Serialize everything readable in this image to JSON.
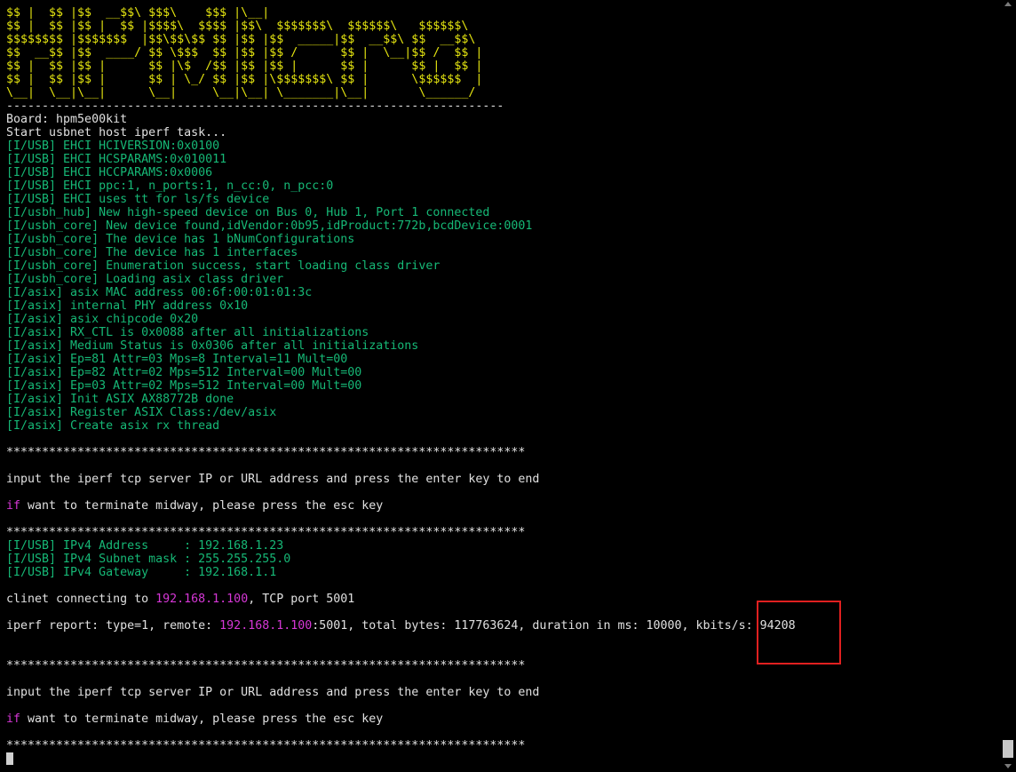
{
  "colors": {
    "background": "#000000",
    "banner": "#e5e510",
    "plain": "#e0e0e0",
    "log": "#16b876",
    "highlight": "#d637d6",
    "annotation_box": "#e02020"
  },
  "banner_lines": [
    "$$ |  $$ |$$  __$$\\ $$$\\    $$$ |\\__|",
    "$$ |  $$ |$$ |  $$ |$$$$\\  $$$$ |$$\\  $$$$$$$\\  $$$$$$\\   $$$$$$\\",
    "$$$$$$$$ |$$$$$$$  |$$\\$$\\$$ $$ |$$ |$$  _____|$$  __$$\\ $$  __$$\\",
    "$$  __$$ |$$  ____/ $$ \\$$$  $$ |$$ |$$ /      $$ |  \\__|$$ /  $$ |",
    "$$ |  $$ |$$ |      $$ |\\$  /$$ |$$ |$$ |      $$ |      $$ |  $$ |",
    "$$ |  $$ |$$ |      $$ | \\_/ $$ |$$ |\\$$$$$$$\\ $$ |      \\$$$$$$  |",
    "\\__|  \\__|\\__|      \\__|     \\__|\\__| \\_______|\\__|       \\______/"
  ],
  "banner_rule": "----------------------------------------------------------------------",
  "board_line": "Board: hpm5e00kit",
  "start_line": "Start usbnet host iperf task...",
  "usb_logs": [
    "[I/USB] EHCI HCIVERSION:0x0100",
    "[I/USB] EHCI HCSPARAMS:0x010011",
    "[I/USB] EHCI HCCPARAMS:0x0006",
    "[I/USB] EHCI ppc:1, n_ports:1, n_cc:0, n_pcc:0",
    "[I/USB] EHCI uses tt for ls/fs device",
    "[I/usbh_hub] New high-speed device on Bus 0, Hub 1, Port 1 connected",
    "[I/usbh_core] New device found,idVendor:0b95,idProduct:772b,bcdDevice:0001",
    "[I/usbh_core] The device has 1 bNumConfigurations",
    "[I/usbh_core] The device has 1 interfaces",
    "[I/usbh_core] Enumeration success, start loading class driver",
    "[I/usbh_core] Loading asix class driver",
    "[I/asix] asix MAC address 00:6f:00:01:01:3c",
    "[I/asix] internal PHY address 0x10",
    "[I/asix] asix chipcode 0x20",
    "[I/asix] RX_CTL is 0x0088 after all initializations",
    "[I/asix] Medium Status is 0x0306 after all initializations",
    "[I/asix] Ep=81 Attr=03 Mps=8 Interval=11 Mult=00",
    "[I/asix] Ep=82 Attr=02 Mps=512 Interval=00 Mult=00",
    "[I/asix] Ep=03 Attr=02 Mps=512 Interval=00 Mult=00",
    "[I/asix] Init ASIX AX88772B done",
    "[I/asix] Register ASIX Class:/dev/asix",
    "[I/asix] Create asix rx thread"
  ],
  "separator": "*************************************************************************",
  "prompt_line": "input the iperf tcp server IP or URL address and press the enter key to end",
  "terminate_keyword": "if",
  "terminate_rest": " want to terminate midway, please press the esc key",
  "ip_logs": [
    "[I/USB] IPv4 Address     : 192.168.1.23",
    "[I/USB] IPv4 Subnet mask : 255.255.255.0",
    "[I/USB] IPv4 Gateway     : 192.168.1.1"
  ],
  "connect": {
    "prefix": "clinet connecting to ",
    "ip": "192.168.1.100",
    "suffix": ", TCP port 5001"
  },
  "report": {
    "prefix": "iperf report: type=1, remote: ",
    "ip": "192.168.1.100",
    "middle": ":5001, total bytes: 117763624, duration in ms: 10000, kbits/s: ",
    "kbits": "94208"
  }
}
